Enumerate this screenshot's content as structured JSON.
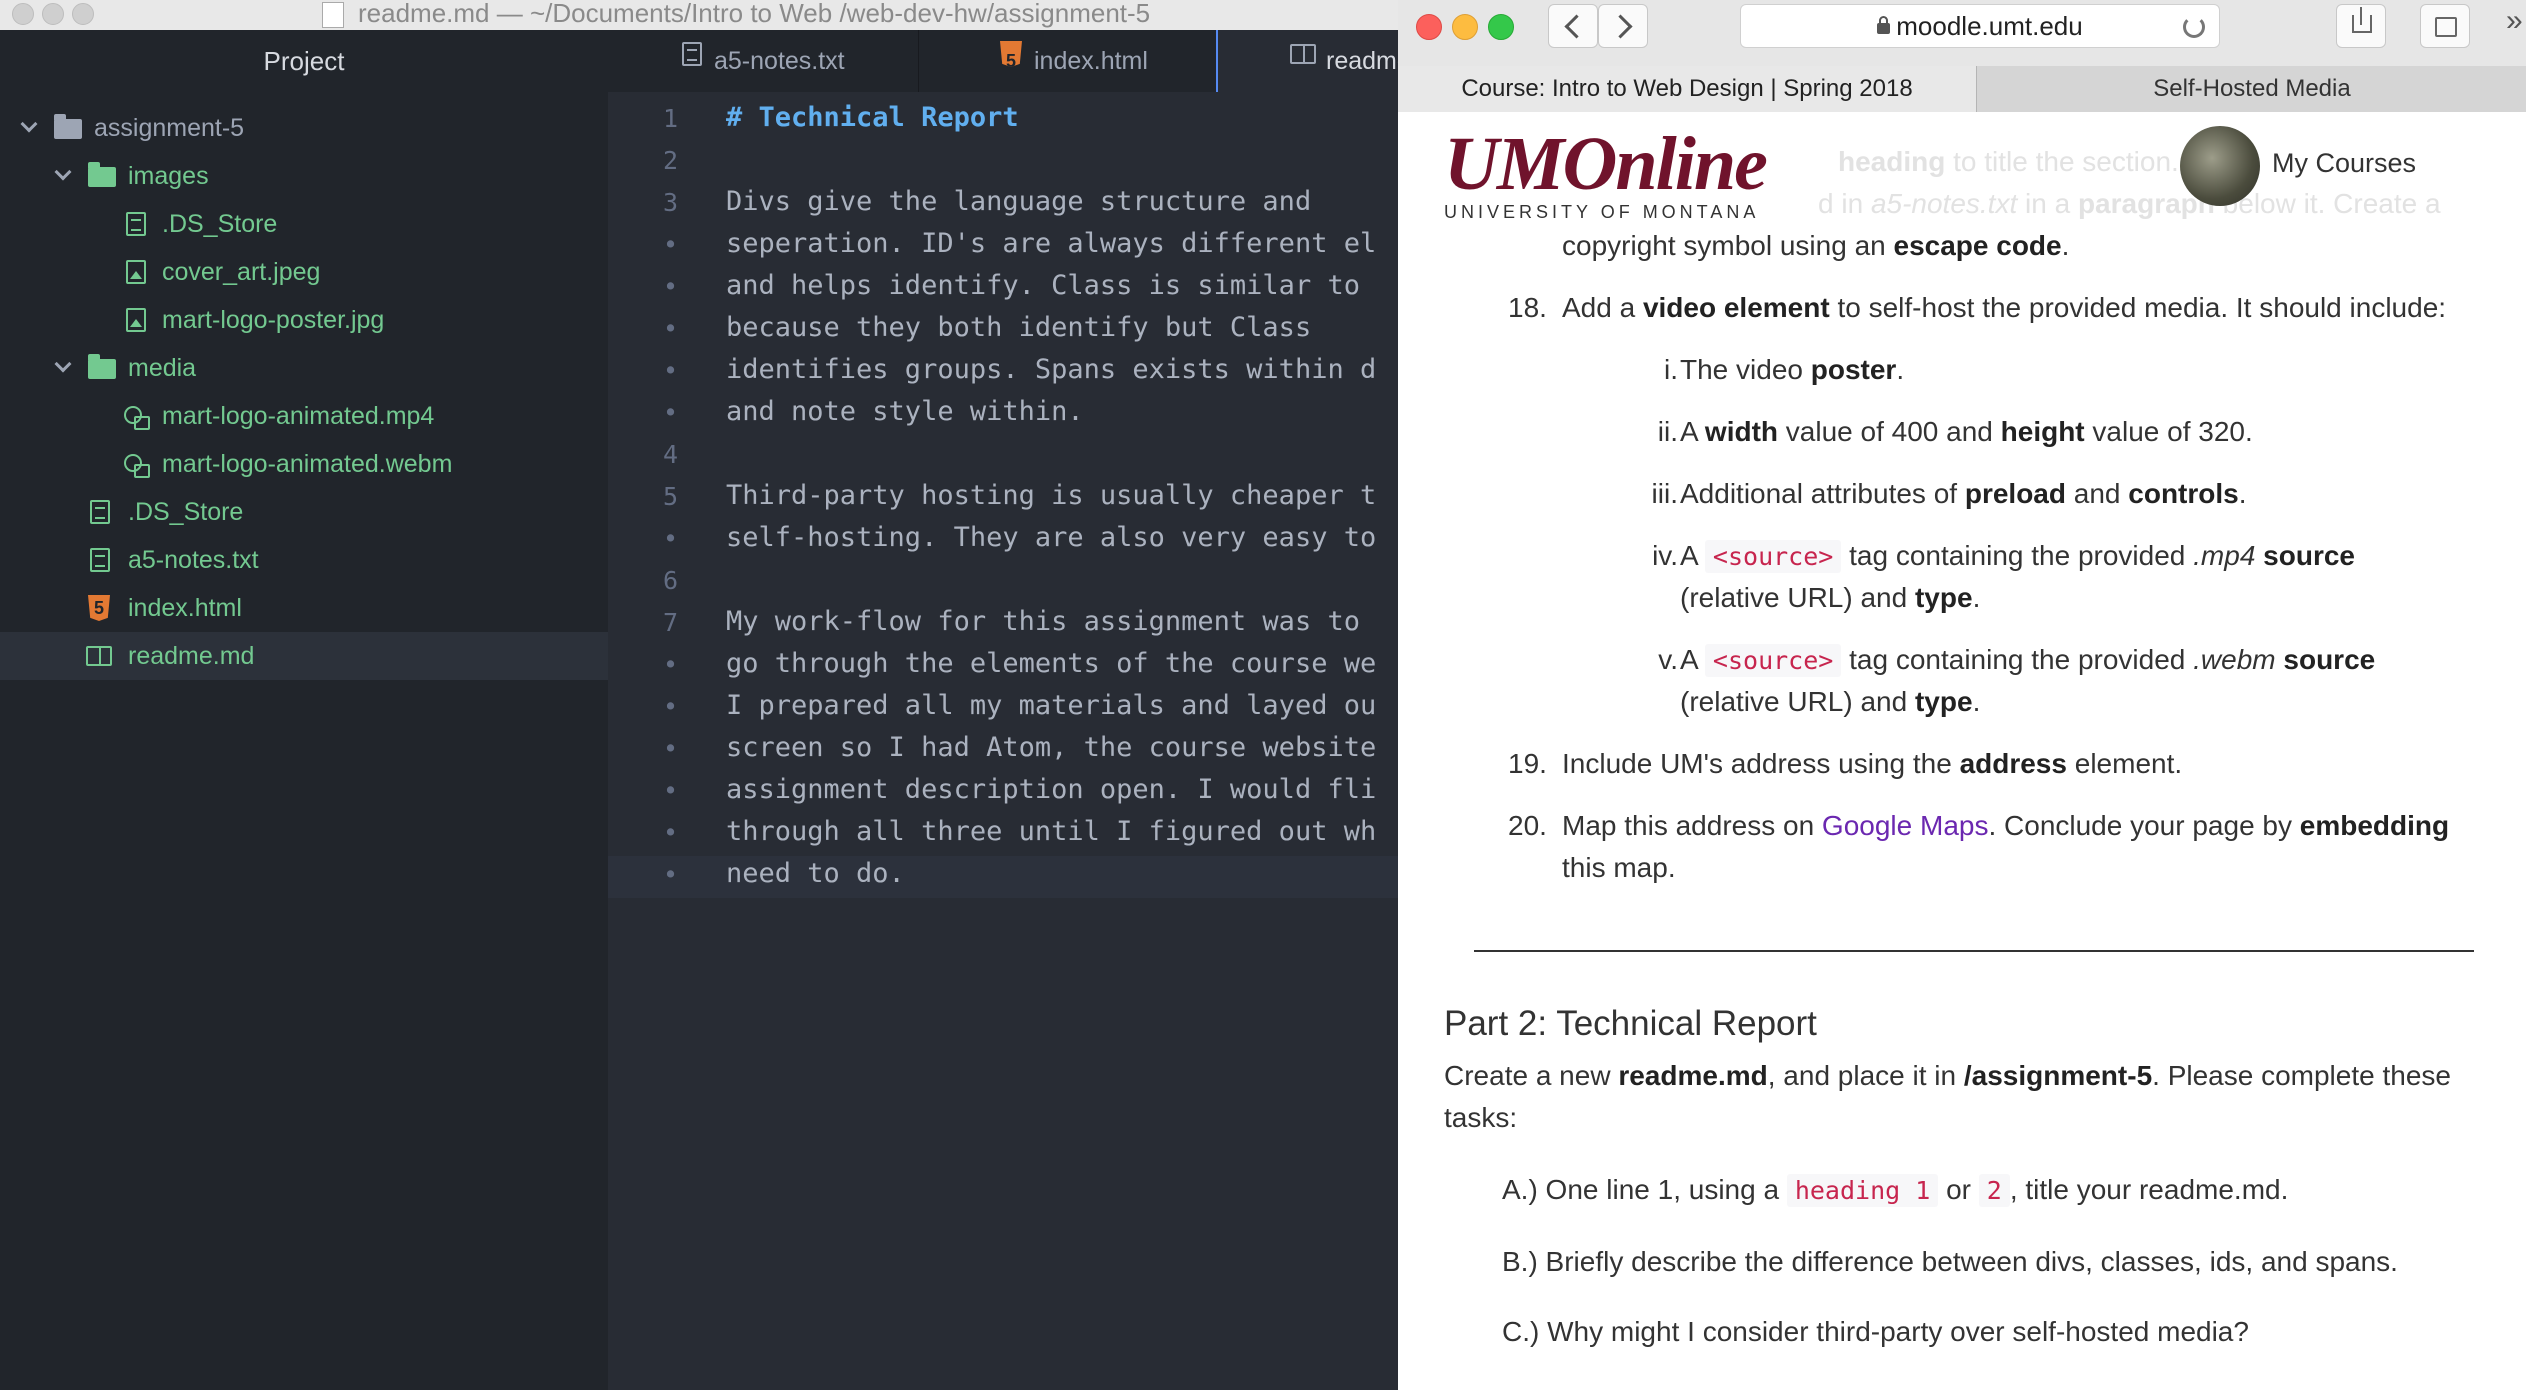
{
  "atom": {
    "window_title": "readme.md — ~/Documents/Intro to Web /web-dev-hw/assignment-5",
    "tree": {
      "header": "Project",
      "items": [
        {
          "label": "assignment-5",
          "kind": "folder"
        },
        {
          "label": "images",
          "kind": "folder"
        },
        {
          "label": ".DS_Store",
          "kind": "file"
        },
        {
          "label": "cover_art.jpeg",
          "kind": "image"
        },
        {
          "label": "mart-logo-poster.jpg",
          "kind": "image"
        },
        {
          "label": "media",
          "kind": "folder"
        },
        {
          "label": "mart-logo-animated.mp4",
          "kind": "media"
        },
        {
          "label": "mart-logo-animated.webm",
          "kind": "media"
        },
        {
          "label": ".DS_Store",
          "kind": "file"
        },
        {
          "label": "a5-notes.txt",
          "kind": "text"
        },
        {
          "label": "index.html",
          "kind": "html"
        },
        {
          "label": "readme.md",
          "kind": "markdown"
        }
      ]
    },
    "tabs": [
      {
        "label": "a5-notes.txt"
      },
      {
        "label": "index.html"
      },
      {
        "label": "readme.md"
      }
    ],
    "editor": {
      "gutter": [
        "1",
        "2",
        "3",
        "•",
        "•",
        "•",
        "•",
        "•",
        "4",
        "5",
        "•",
        "6",
        "7",
        "•",
        "•",
        "•",
        "•",
        "•",
        "•"
      ],
      "lines": [
        "# Technical Report",
        "",
        "Divs give the language structure and",
        "seperation. ID's are always different el",
        "and helps identify. Class is similar to",
        "because they both identify but Class",
        "identifies groups. Spans exists within d",
        "and note style within.",
        "",
        "Third-party hosting is usually cheaper t",
        "self-hosting. They are also very easy to",
        "",
        "My work-flow for this assignment was to",
        "go through the elements of the course we",
        "I prepared all my materials and layed ou",
        "screen so I had Atom, the course website",
        "assignment description open. I would fli",
        "through all three until I figured out wh",
        "need to do."
      ]
    }
  },
  "safari": {
    "url": "moodle.umt.edu",
    "tabs": [
      {
        "label": "Course: Intro to Web Design | Spring 2018"
      },
      {
        "label": "Self-Hosted Media"
      }
    ],
    "colors": {
      "brand": "#70132c",
      "link": "#6b28b0",
      "code": "#c7254e"
    },
    "header": {
      "logo_main": "UMOnline",
      "logo_sub": "UNIVERSITY OF MONTANA",
      "my_courses": "My Courses"
    },
    "content": {
      "faded_line1_a": "heading",
      "faded_line1_b": " to title the section. Add",
      "faded_line2_a": "d in ",
      "faded_line2_b": "a5-notes.txt",
      "faded_line2_c": " in a ",
      "faded_line2_d": "paragraph",
      "faded_line2_e": " below it. Create a",
      "copyright_a": "copyright symbol using an ",
      "copyright_b": "escape code",
      "copyright_c": ".",
      "item18_num": "18.",
      "item18_a": "Add a ",
      "item18_b": "video element",
      "item18_c": " to self-host the provided media. It should include:",
      "sub_i_num": "i.",
      "sub_i_a": "The video ",
      "sub_i_b": "poster",
      "sub_i_c": ".",
      "sub_ii_num": "ii.",
      "sub_ii_a": "A ",
      "sub_ii_b": "width",
      "sub_ii_c": " value of 400 and ",
      "sub_ii_d": "height",
      "sub_ii_e": " value of 320.",
      "sub_iii_num": "iii.",
      "sub_iii_a": "Additional attributes of ",
      "sub_iii_b": "preload",
      "sub_iii_c": " and ",
      "sub_iii_d": "controls",
      "sub_iii_e": ".",
      "sub_iv_num": "iv.",
      "sub_iv_a": "A ",
      "sub_iv_code": "<source>",
      "sub_iv_b": " tag containing the provided ",
      "sub_iv_c": ".mp4",
      "sub_iv_d": " source",
      "sub_iv_line2_a": "(relative URL) and ",
      "sub_iv_line2_b": "type",
      "sub_iv_line2_c": ".",
      "sub_v_num": "v.",
      "sub_v_a": "A ",
      "sub_v_code": "<source>",
      "sub_v_b": " tag containing the provided ",
      "sub_v_c": ".webm",
      "sub_v_d": " source",
      "sub_v_line2_a": "(relative URL) and ",
      "sub_v_line2_b": "type",
      "sub_v_line2_c": ".",
      "item19_num": "19.",
      "item19_a": "Include UM's address using the ",
      "item19_b": "address",
      "item19_c": " element.",
      "item20_num": "20.",
      "item20_a": "Map this address on ",
      "item20_link": "Google Maps",
      "item20_b": ". Conclude your page by ",
      "item20_c": "embedding",
      "item20_line2": "this map.",
      "part2_title": "Part 2: Technical Report",
      "part2_intro_a": "Create a new ",
      "part2_intro_b": "readme.md",
      "part2_intro_c": ", and place it in ",
      "part2_intro_d": "/assignment-5",
      "part2_intro_e": ". Please complete these",
      "part2_intro_line2": "tasks:",
      "taskA_a": "A.) One line 1, using a ",
      "taskA_code1": "heading 1",
      "taskA_b": " or ",
      "taskA_code2": "2",
      "taskA_c": ", title your readme.md.",
      "taskB": "B.) Briefly describe the difference between divs, classes, ids, and spans.",
      "taskC": "C.) Why might I consider third-party over self-hosted media?"
    }
  }
}
